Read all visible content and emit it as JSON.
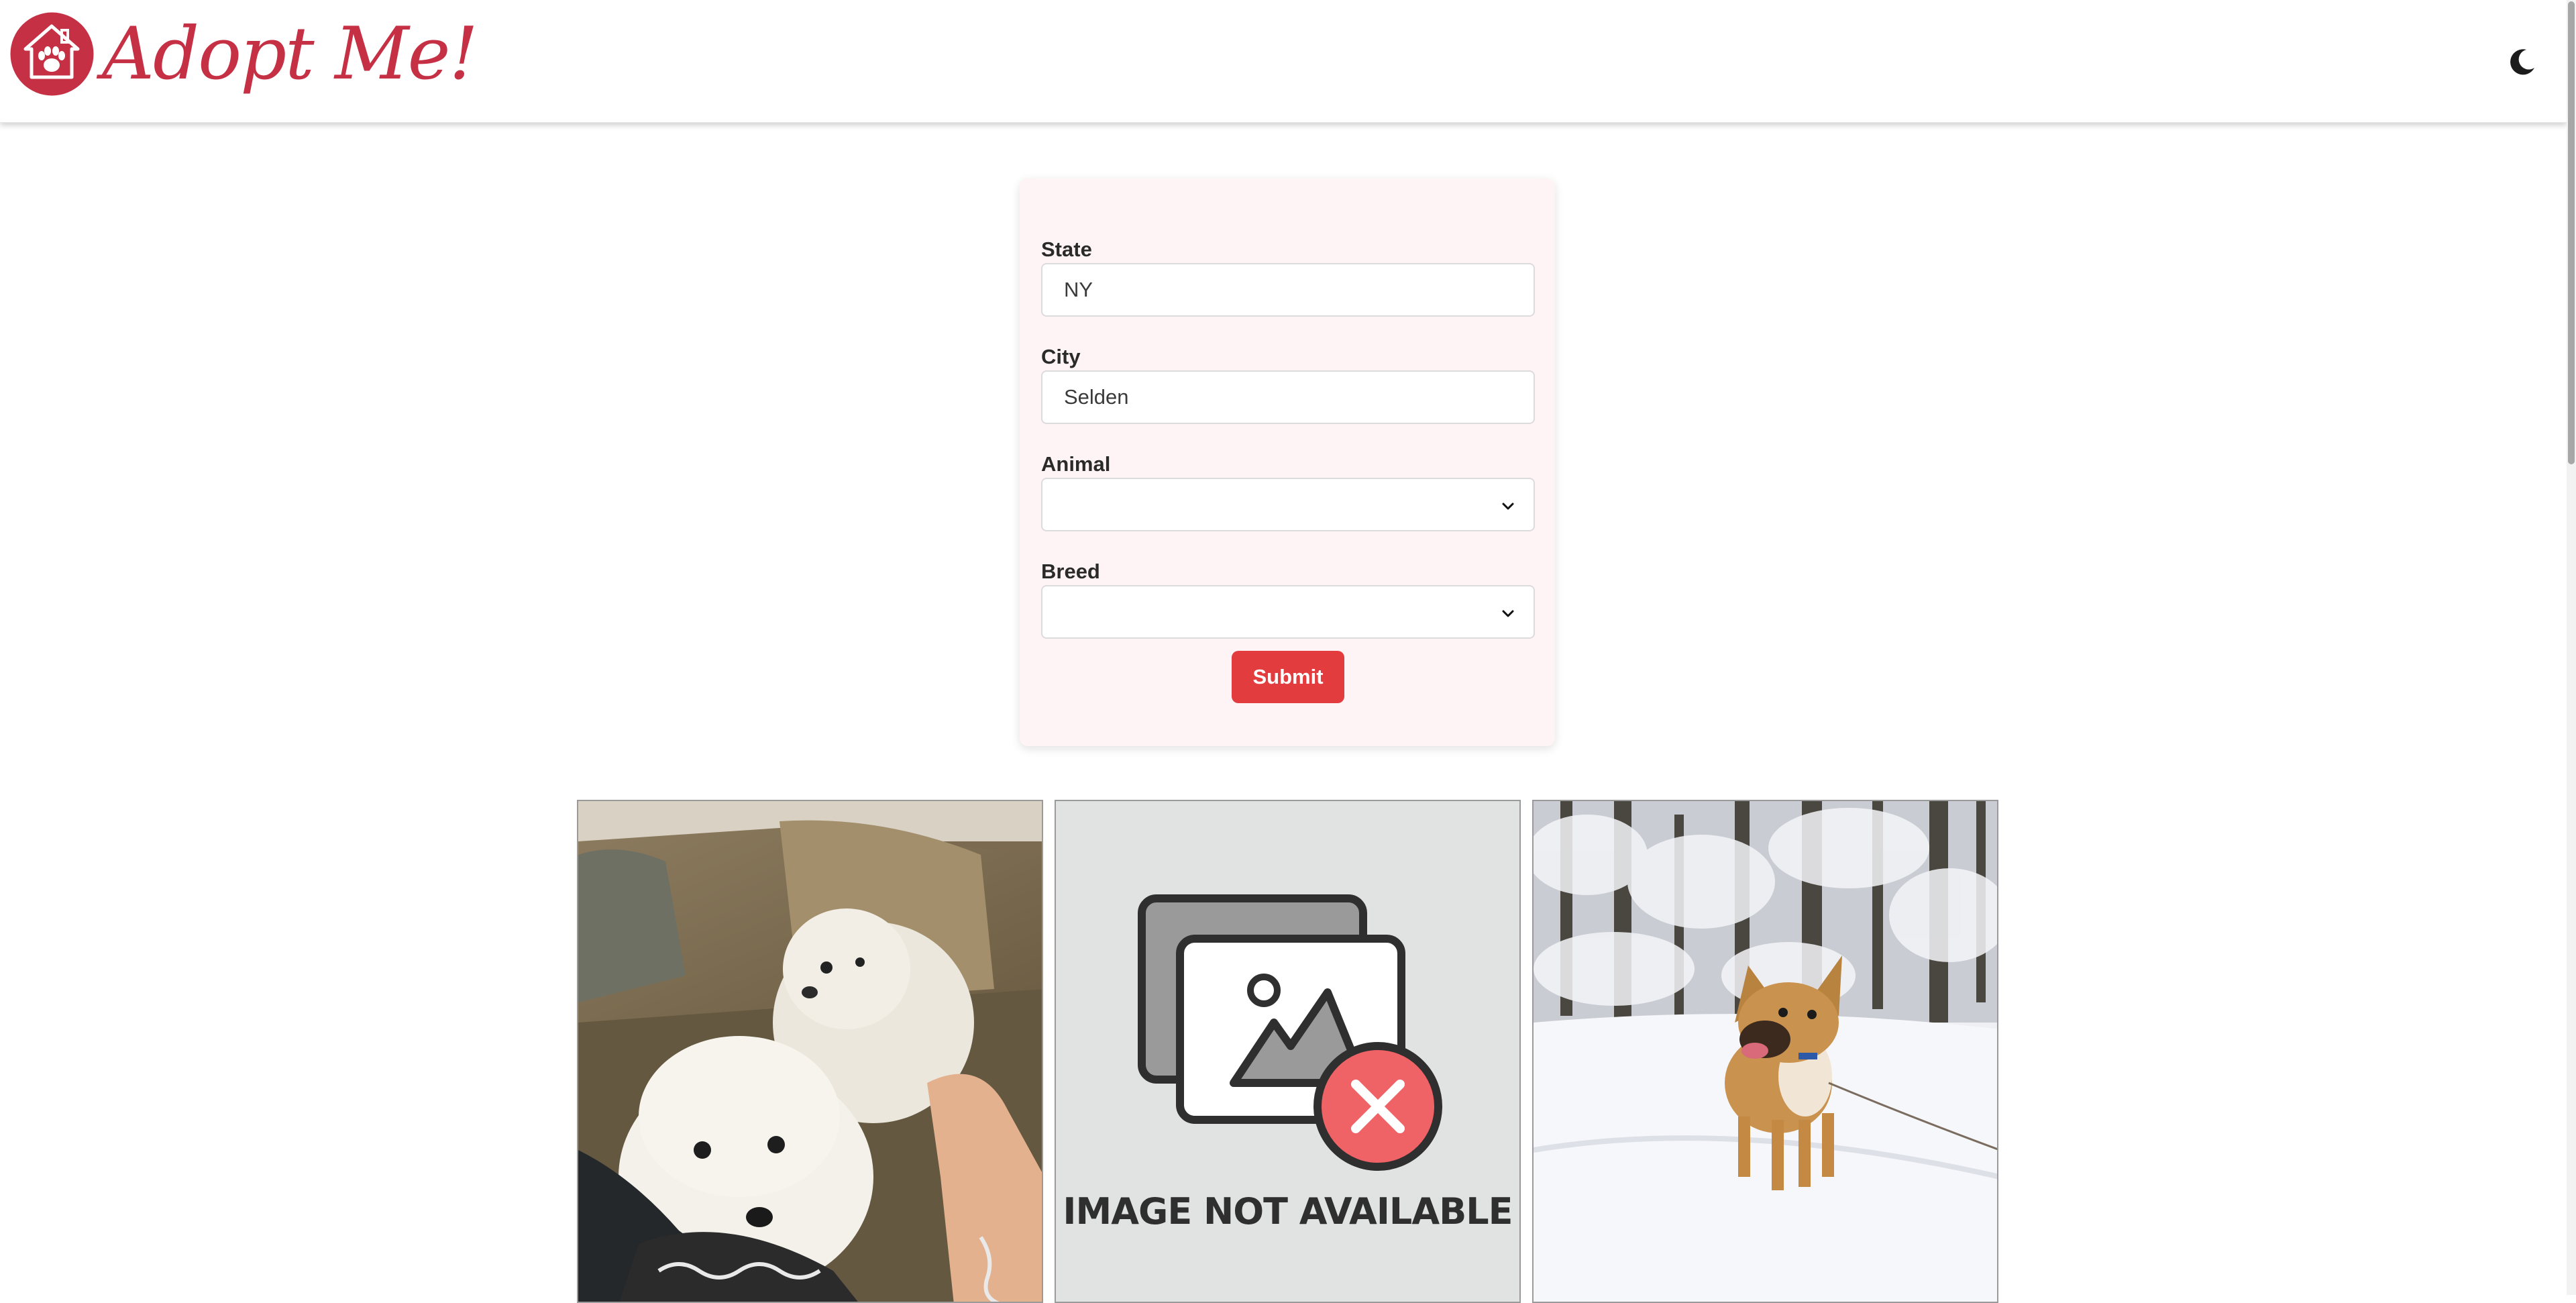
{
  "app": {
    "title": "Adopt Me!",
    "logo_icon": "house-paw-icon",
    "theme_toggle_icon": "moon-icon",
    "brand_color": "#c53045"
  },
  "search": {
    "state_label": "State",
    "state_value": "NY",
    "city_label": "City",
    "city_value": "Selden",
    "animal_label": "Animal",
    "animal_value": "",
    "breed_label": "Breed",
    "breed_value": "",
    "submit_label": "Submit",
    "submit_color": "#e23c3f",
    "card_background": "#fff4f5"
  },
  "results": [
    {
      "image": "two-white-poodles-on-couch"
    },
    {
      "image": "image-not-available-placeholder",
      "caption": "IMAGE NOT AVAILABLE"
    },
    {
      "image": "dog-standing-in-snow"
    }
  ]
}
